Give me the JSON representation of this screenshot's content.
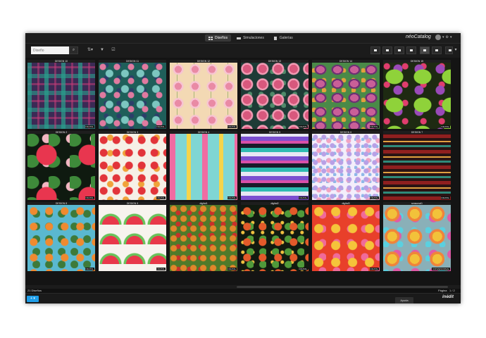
{
  "topbar": {
    "tabs": [
      {
        "label": "Diseños",
        "icon": "grid-icon",
        "active": true
      },
      {
        "label": "Simulaciones",
        "icon": "layers-icon",
        "active": false
      },
      {
        "label": "Galerías",
        "icon": "book-icon",
        "active": false
      }
    ],
    "brand": "néoCatalog",
    "brand_accent": "#ff2a4d"
  },
  "toolbar": {
    "search_placeholder": "Diseño"
  },
  "designs": [
    {
      "name": "DESIGN 10",
      "tag": "DIGITAL"
    },
    {
      "name": "DESIGN 11",
      "tag": "DIGITAL"
    },
    {
      "name": "DESIGN 12",
      "tag": "DIGITAL"
    },
    {
      "name": "DESIGN 13",
      "tag": "DIGITAL"
    },
    {
      "name": "DESIGN 14",
      "tag": "DIGITAL"
    },
    {
      "name": "DESIGN 15",
      "tag": "DIGITAL"
    },
    {
      "name": "DESIGN 2",
      "tag": "DIGITAL"
    },
    {
      "name": "DESIGN 3",
      "tag": "DIGITAL"
    },
    {
      "name": "DESIGN 4",
      "tag": "DIGITAL"
    },
    {
      "name": "DESIGN 5",
      "tag": "DIGITAL"
    },
    {
      "name": "DESIGN 6",
      "tag": "DIGITAL"
    },
    {
      "name": "DESIGN 7",
      "tag": "DIGITAL"
    },
    {
      "name": "DESIGN 8",
      "tag": "DIGITAL"
    },
    {
      "name": "DESIGN 9",
      "tag": "DIGITAL"
    },
    {
      "name": "digital1",
      "tag": "DIGITAL"
    },
    {
      "name": "digital2",
      "tag": "DIGITAL"
    },
    {
      "name": "digital3",
      "tag": "DIGITAL"
    },
    {
      "name": "seasonal1",
      "tag": "CONVENCIONAL"
    }
  ],
  "status": {
    "count": "21 Diseños",
    "page_label": "Página",
    "page": "1 / 2"
  },
  "footer": {
    "add_label": "+ ▾",
    "help": "Ayuda",
    "logo": "inédit"
  }
}
